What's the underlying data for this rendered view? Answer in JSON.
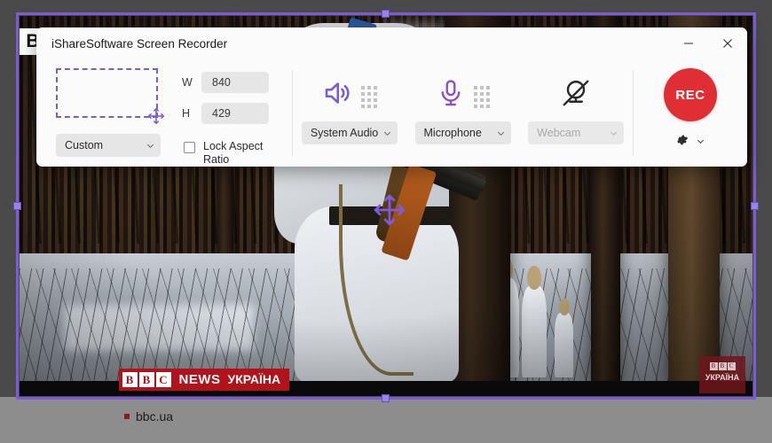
{
  "window": {
    "title": "iShareSoftware Screen Recorder",
    "minimize_label": "–",
    "close_label": "✕"
  },
  "capture": {
    "region_preset_label": "Custom",
    "width_key": "W",
    "width_value": "840",
    "height_key": "H",
    "height_value": "429",
    "lock_aspect_label": "Lock Aspect Ratio",
    "lock_aspect_checked": false
  },
  "devices": [
    {
      "name": "system-audio",
      "icon": "speaker-icon",
      "label": "System Audio",
      "enabled": true
    },
    {
      "name": "microphone",
      "icon": "microphone-icon",
      "label": "Microphone",
      "enabled": true
    },
    {
      "name": "webcam",
      "icon": "webcam-off-icon",
      "label": "Webcam",
      "enabled": false
    }
  ],
  "record": {
    "button_label": "REC",
    "button_color": "#df2f34",
    "settings_icon": "gear-icon",
    "settings_chevron": "chevron-down-icon"
  },
  "selection": {
    "accent_color": "#7b5cd6",
    "handle_color": "#9b84e8",
    "move_icon": "move-arrows-icon"
  },
  "background": {
    "letter_tile": "B",
    "page_url": "bbc.ua",
    "banner": {
      "blocks": [
        "B",
        "B",
        "C"
      ],
      "text": "NEWS",
      "sub": "УКРАЇНА",
      "color": "#b2131a"
    },
    "watermark": {
      "blocks": [
        "B",
        "B",
        "C"
      ],
      "text": "УКРАЇНА"
    }
  }
}
